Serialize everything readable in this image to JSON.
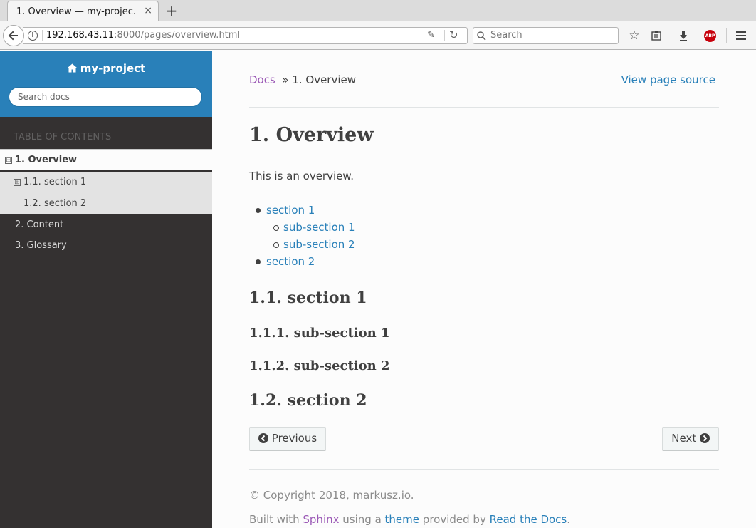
{
  "browser": {
    "tab_title": "1. Overview — my-projec...",
    "tab_close": "×",
    "new_tab": "+",
    "url_host": "192.168.43.11",
    "url_rest": ":8000/pages/overview.html",
    "search_placeholder": "Search"
  },
  "sidebar": {
    "project_name": "my-project",
    "search_placeholder": "Search docs",
    "toc_caption": "TABLE OF CONTENTS",
    "items": [
      {
        "label": "1. Overview",
        "expander": "⊟"
      },
      {
        "label": "1.1. section 1",
        "expander": "⊞"
      },
      {
        "label": "1.2. section 2"
      },
      {
        "label": "2. Content"
      },
      {
        "label": "3. Glossary"
      }
    ]
  },
  "breadcrumb": {
    "docs": "Docs",
    "separator": "»",
    "current": "1. Overview",
    "view_source": "View page source"
  },
  "main": {
    "title": "1. Overview",
    "intro": "This is an overview.",
    "toc_list": [
      {
        "label": "section 1",
        "children": [
          "sub-section 1",
          "sub-section 2"
        ]
      },
      {
        "label": "section 2"
      }
    ],
    "headings": {
      "h_section1": "1.1. section 1",
      "h_sub1": "1.1.1. sub-section 1",
      "h_sub2": "1.1.2. sub-section 2",
      "h_section2": "1.2. section 2"
    },
    "prev_label": "Previous",
    "next_label": "Next"
  },
  "footer": {
    "copyright": "© Copyright 2018, markusz.io.",
    "built_prefix": "Built with",
    "sphinx": "Sphinx",
    "using_a": "using a",
    "theme": "theme",
    "provided_by": "provided by",
    "rtd": "Read the Docs",
    "period": "."
  },
  "colors": {
    "sidebar_header": "#2980b9",
    "sidebar_bg": "#343131",
    "link": "#2980b9",
    "visited_link": "#9b59b6"
  }
}
